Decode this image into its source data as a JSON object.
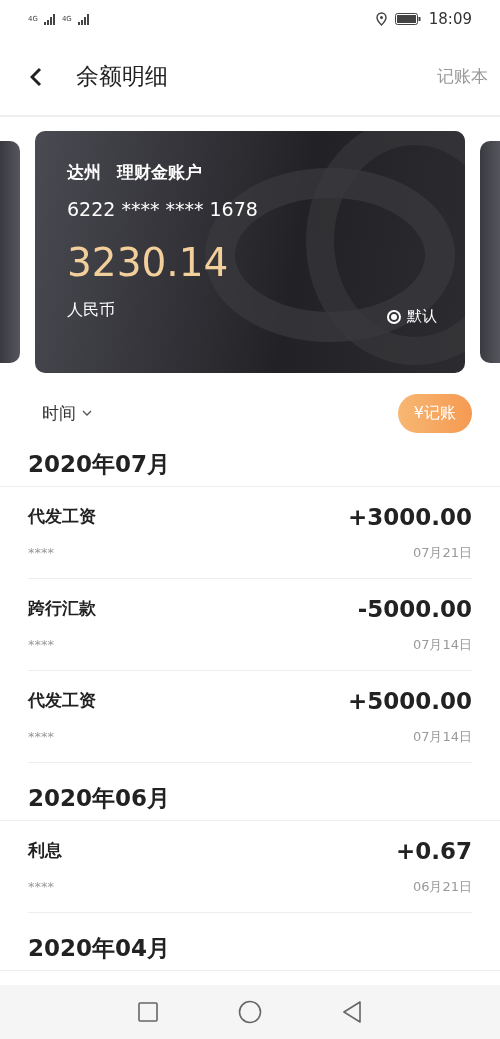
{
  "status_bar": {
    "time": "18:09",
    "network": [
      "4G",
      "4G"
    ]
  },
  "header": {
    "title": "余额明细",
    "action": "记账本"
  },
  "card": {
    "bank": "达州",
    "account_type": "理财金账户",
    "number": "6222 **** **** 1678",
    "balance": "3230.14",
    "currency": "人民币",
    "default": {
      "label": "默认",
      "selected": true
    }
  },
  "filter": {
    "label": "时间"
  },
  "record_button": "¥记账",
  "groups": [
    {
      "month": "2020年07月",
      "items": [
        {
          "title": "代发工资",
          "amount": "+3000.00",
          "note": "****",
          "date": "07月21日"
        },
        {
          "title": "跨行汇款",
          "amount": "-5000.00",
          "note": "****",
          "date": "07月14日"
        },
        {
          "title": "代发工资",
          "amount": "+5000.00",
          "note": "****",
          "date": "07月14日"
        }
      ]
    },
    {
      "month": "2020年06月",
      "items": [
        {
          "title": "利息",
          "amount": "+0.67",
          "note": "****",
          "date": "06月21日"
        }
      ]
    },
    {
      "month": "2020年04月"
    }
  ]
}
